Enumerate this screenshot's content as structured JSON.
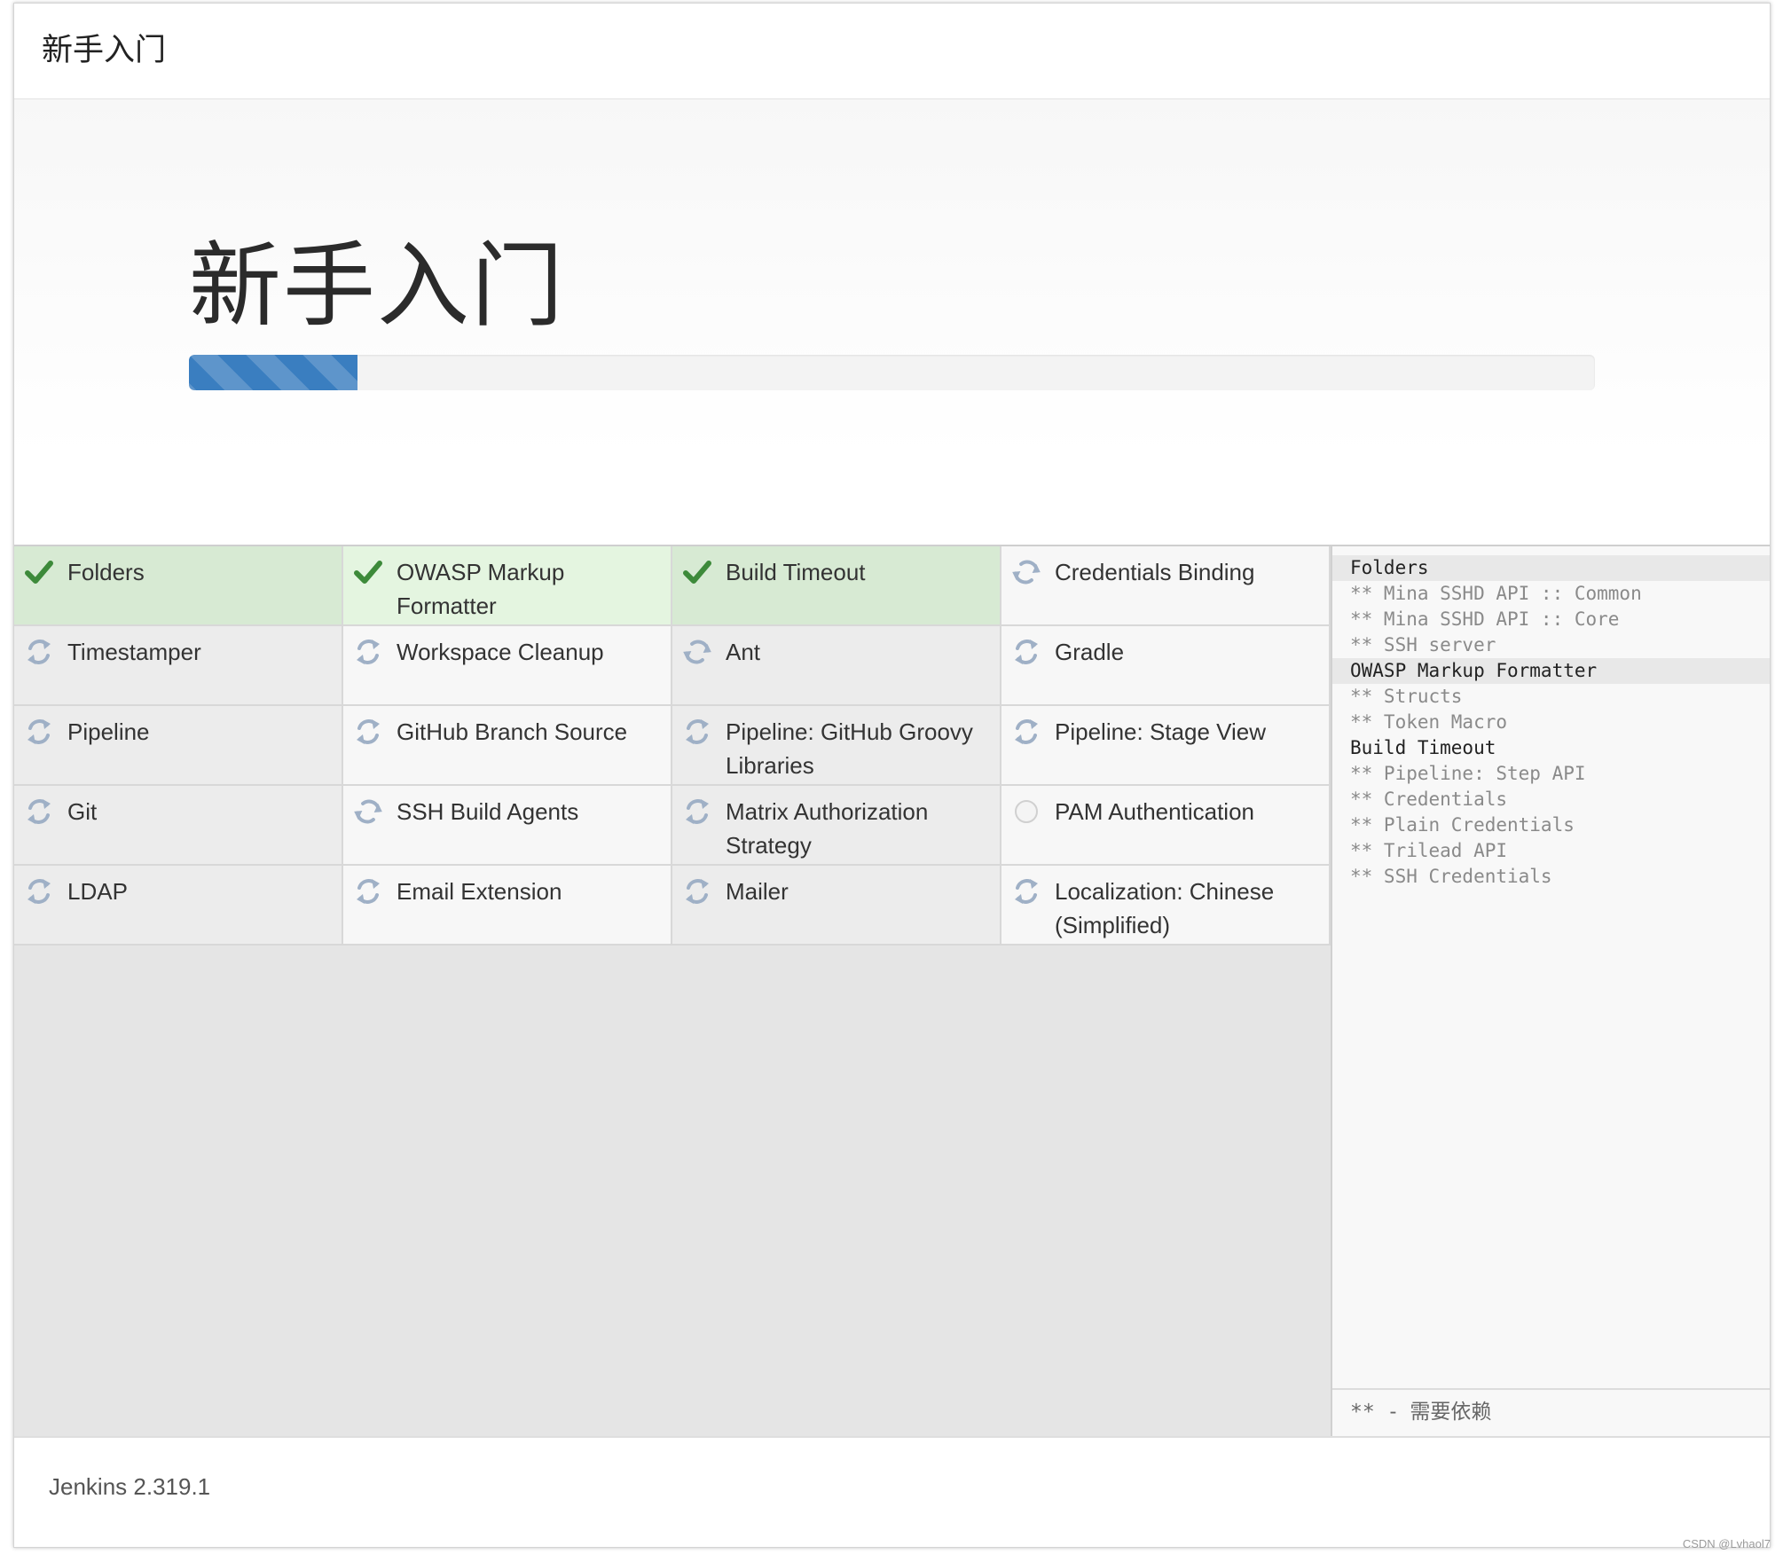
{
  "header": {
    "title": "新手入门"
  },
  "hero": {
    "title": "新手入门",
    "progress_percent": 12
  },
  "colors": {
    "success": "#3d8a3a",
    "pending": "#9fb0c6",
    "progress": "#3a7ec0",
    "done_bg": "#d7ead3"
  },
  "plugins": [
    {
      "name": "Folders",
      "status": "success"
    },
    {
      "name": "OWASP Markup Formatter",
      "status": "success"
    },
    {
      "name": "Build Timeout",
      "status": "success"
    },
    {
      "name": "Credentials Binding",
      "status": "installing"
    },
    {
      "name": "Timestamper",
      "status": "pending"
    },
    {
      "name": "Workspace Cleanup",
      "status": "pending"
    },
    {
      "name": "Ant",
      "status": "installing"
    },
    {
      "name": "Gradle",
      "status": "pending"
    },
    {
      "name": "Pipeline",
      "status": "pending"
    },
    {
      "name": "GitHub Branch Source",
      "status": "pending"
    },
    {
      "name": "Pipeline: GitHub Groovy Libraries",
      "status": "pending"
    },
    {
      "name": "Pipeline: Stage View",
      "status": "pending"
    },
    {
      "name": "Git",
      "status": "pending"
    },
    {
      "name": "SSH Build Agents",
      "status": "installing"
    },
    {
      "name": "Matrix Authorization Strategy",
      "status": "pending"
    },
    {
      "name": "PAM Authentication",
      "status": "not-started"
    },
    {
      "name": "LDAP",
      "status": "pending"
    },
    {
      "name": "Email Extension",
      "status": "pending"
    },
    {
      "name": "Mailer",
      "status": "pending"
    },
    {
      "name": "Localization: Chinese (Simplified)",
      "status": "pending"
    }
  ],
  "log": [
    {
      "text": "Folders",
      "type": "plugin",
      "highlight": true
    },
    {
      "text": "** Mina SSHD API :: Common",
      "type": "dep"
    },
    {
      "text": "** Mina SSHD API :: Core",
      "type": "dep"
    },
    {
      "text": "** SSH server",
      "type": "dep"
    },
    {
      "text": "OWASP Markup Formatter",
      "type": "plugin",
      "highlight": true
    },
    {
      "text": "** Structs",
      "type": "dep"
    },
    {
      "text": "** Token Macro",
      "type": "dep"
    },
    {
      "text": "Build Timeout",
      "type": "plugin",
      "highlight": false
    },
    {
      "text": "** Pipeline: Step API",
      "type": "dep"
    },
    {
      "text": "** Credentials",
      "type": "dep"
    },
    {
      "text": "** Plain Credentials",
      "type": "dep"
    },
    {
      "text": "** Trilead API",
      "type": "dep"
    },
    {
      "text": "** SSH Credentials",
      "type": "dep"
    }
  ],
  "legend": {
    "mark": "** -",
    "text": "需要依赖"
  },
  "footer": {
    "version": "Jenkins 2.319.1"
  },
  "watermark": "CSDN @Lvhaol7"
}
